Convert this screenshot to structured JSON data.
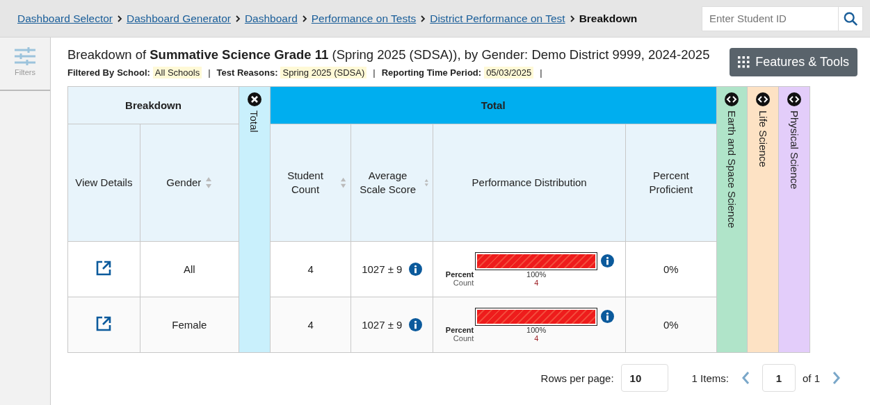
{
  "breadcrumbs": [
    {
      "label": "Dashboard Selector",
      "current": false
    },
    {
      "label": "Dashboard Generator",
      "current": false
    },
    {
      "label": "Dashboard",
      "current": false
    },
    {
      "label": "Performance on Tests",
      "current": false
    },
    {
      "label": "District Performance on Test",
      "current": false
    },
    {
      "label": "Breakdown",
      "current": true
    }
  ],
  "search": {
    "placeholder": "Enter Student ID"
  },
  "sidebar": {
    "filters": {
      "label": "Filters",
      "disabled": true
    }
  },
  "report": {
    "title": "Breakdown of **Summative Science Grade 11** (Spring 2025 (SDSA)), by Gender: Demo District 9999, 2024-2025",
    "filters": [
      {
        "label": "Filtered By"
      },
      {
        "label": "School:",
        "value": "All Schools"
      },
      {
        "label": "Test Reasons:",
        "value": "Spring 2025 (SDSA)"
      },
      {
        "label": "Reporting Time Period:",
        "value": "05/03/2025"
      }
    ],
    "separator": "|",
    "features_button": "Features & Tools"
  },
  "table": {
    "breakdown_header": "Breakdown",
    "total_header": "Total",
    "breakdown_columns": [
      {
        "label": "View Details",
        "sortable": false
      },
      {
        "label": "Gender",
        "sortable": true
      }
    ],
    "total_columns": [
      {
        "label": "Student Count",
        "sortable": true
      },
      {
        "label": "Average Scale Score",
        "sortable": true
      },
      {
        "label": "Performance Distribution",
        "sortable": false
      },
      {
        "label": "Percent Proficient",
        "sortable": false
      }
    ],
    "collapsed_columns": [
      {
        "label": "Total",
        "expanded": true,
        "color": "#c9f0fc"
      },
      {
        "label": "Earth and Space Science",
        "expanded": false,
        "color": "#b0e4c9"
      },
      {
        "label": "Life Science",
        "expanded": false,
        "color": "#fde2c4"
      },
      {
        "label": "Physical Science",
        "expanded": false,
        "color": "#e3cdfa"
      }
    ],
    "rows": [
      {
        "gender": "All",
        "student_count": "4",
        "average_scale_score": "1027 ± 9",
        "distribution": {
          "level": 1,
          "percent_label": "Percent",
          "count_label": "Count",
          "percent": "100%",
          "count": "4"
        },
        "percent_proficient": "0%"
      },
      {
        "gender": "Female",
        "student_count": "4",
        "average_scale_score": "1027 ± 9",
        "distribution": {
          "level": 1,
          "percent_label": "Percent",
          "count_label": "Count",
          "percent": "100%",
          "count": "4"
        },
        "percent_proficient": "0%"
      }
    ]
  },
  "pagination": {
    "rows_label": "Rows per page:",
    "rows_value": "10",
    "items_label": "1 Items:",
    "page_value": "1",
    "of_label": "of 1"
  }
}
